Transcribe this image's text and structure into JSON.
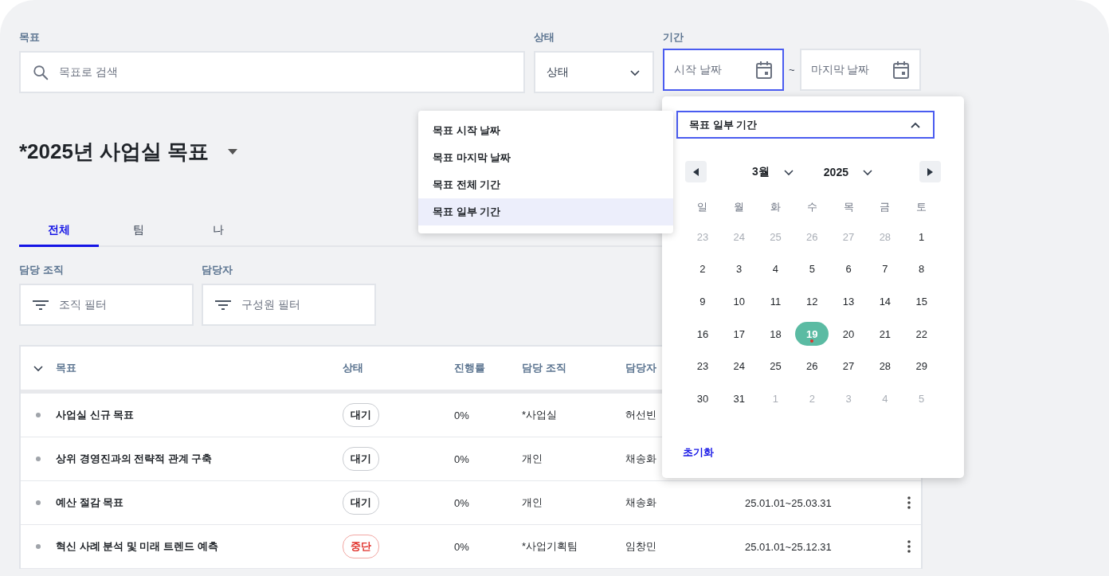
{
  "filters": {
    "goal": {
      "label": "목표",
      "placeholder": "목표로 검색"
    },
    "status": {
      "label": "상태",
      "placeholder": "상태"
    },
    "period": {
      "label": "기간",
      "separator": "~",
      "fields": [
        {
          "placeholder": "시작 날짜",
          "focused": true
        },
        {
          "placeholder": "마지막 날짜",
          "focused": false
        }
      ]
    }
  },
  "title": "*2025년 사업실 목표",
  "tabs": [
    {
      "label": "전체",
      "selected": true
    },
    {
      "label": "팀",
      "selected": false
    },
    {
      "label": "나",
      "selected": false
    }
  ],
  "people_filters": [
    {
      "label": "담당 조직",
      "placeholder": "조직 필터"
    },
    {
      "label": "담당자",
      "placeholder": "구성원 필터"
    }
  ],
  "table": {
    "columns": [
      "목표",
      "상태",
      "진행률",
      "담당 조직",
      "담당자"
    ],
    "rows": [
      {
        "goal": "사업실 신규 목표",
        "status": {
          "text": "대기",
          "kind": "waiting"
        },
        "progress": "0%",
        "org": "*사업실",
        "owner": "허선빈"
      },
      {
        "goal": "상위 경영진과의 전략적 관계 구축",
        "status": {
          "text": "대기",
          "kind": "waiting"
        },
        "progress": "0%",
        "org": "개인",
        "owner": "채송화"
      },
      {
        "goal": "예산 절감 목표",
        "status": {
          "text": "대기",
          "kind": "waiting"
        },
        "progress": "0%",
        "org": "개인",
        "owner": "채송화",
        "period": "25.01.01~25.03.31"
      },
      {
        "goal": "혁신 사례 분석 및 미래 트렌드 예측",
        "status": {
          "text": "중단",
          "kind": "stopped"
        },
        "progress": "0%",
        "org": "*사업기획팀",
        "owner": "임창민",
        "period": "25.01.01~25.12.31"
      }
    ]
  },
  "period_menu": {
    "items": [
      {
        "label": "목표 시작 날짜",
        "selected": false
      },
      {
        "label": "목표 마지막 날짜",
        "selected": false
      },
      {
        "label": "목표 전체 기간",
        "selected": false
      },
      {
        "label": "목표 일부 기간",
        "selected": true
      }
    ]
  },
  "calendar": {
    "mode": "목표 일부 기간",
    "month": "3월",
    "year": "2025",
    "weekdays": [
      "일",
      "월",
      "화",
      "수",
      "목",
      "금",
      "토"
    ],
    "weeks": [
      [
        {
          "day": "23",
          "muted": true
        },
        {
          "day": "24",
          "muted": true
        },
        {
          "day": "25",
          "muted": true
        },
        {
          "day": "26",
          "muted": true
        },
        {
          "day": "27",
          "muted": true
        },
        {
          "day": "28",
          "muted": true
        },
        {
          "day": "1",
          "muted": false
        }
      ],
      [
        {
          "day": "2",
          "muted": false
        },
        {
          "day": "3",
          "muted": false
        },
        {
          "day": "4",
          "muted": false
        },
        {
          "day": "5",
          "muted": false
        },
        {
          "day": "6",
          "muted": false
        },
        {
          "day": "7",
          "muted": false
        },
        {
          "day": "8",
          "muted": false
        }
      ],
      [
        {
          "day": "9",
          "muted": false
        },
        {
          "day": "10",
          "muted": false
        },
        {
          "day": "11",
          "muted": false
        },
        {
          "day": "12",
          "muted": false
        },
        {
          "day": "13",
          "muted": false
        },
        {
          "day": "14",
          "muted": false
        },
        {
          "day": "15",
          "muted": false
        }
      ],
      [
        {
          "day": "16",
          "muted": false
        },
        {
          "day": "17",
          "muted": false
        },
        {
          "day": "18",
          "muted": false
        },
        {
          "day": "19",
          "muted": false,
          "selected": true,
          "today": true
        },
        {
          "day": "20",
          "muted": false
        },
        {
          "day": "21",
          "muted": false
        },
        {
          "day": "22",
          "muted": false
        }
      ],
      [
        {
          "day": "23",
          "muted": false
        },
        {
          "day": "24",
          "muted": false
        },
        {
          "day": "25",
          "muted": false
        },
        {
          "day": "26",
          "muted": false
        },
        {
          "day": "27",
          "muted": false
        },
        {
          "day": "28",
          "muted": false
        },
        {
          "day": "29",
          "muted": false
        }
      ],
      [
        {
          "day": "30",
          "muted": false
        },
        {
          "day": "31",
          "muted": false
        },
        {
          "day": "1",
          "muted": true
        },
        {
          "day": "2",
          "muted": true
        },
        {
          "day": "3",
          "muted": true
        },
        {
          "day": "4",
          "muted": true
        },
        {
          "day": "5",
          "muted": true
        }
      ]
    ],
    "reset": "초기화"
  }
}
